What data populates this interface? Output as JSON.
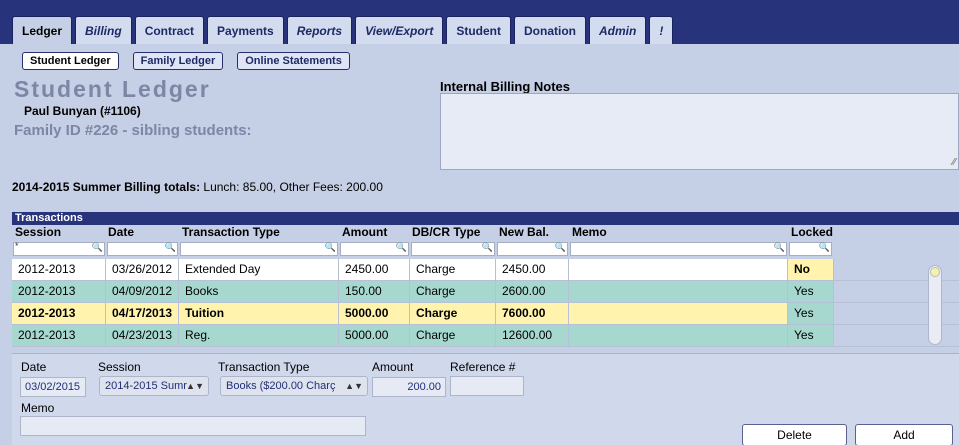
{
  "tabs": [
    {
      "label": "Ledger",
      "italic": false,
      "active": true
    },
    {
      "label": "Billing",
      "italic": true,
      "active": false
    },
    {
      "label": "Contract",
      "italic": false,
      "active": false
    },
    {
      "label": "Payments",
      "italic": false,
      "active": false
    },
    {
      "label": "Reports",
      "italic": true,
      "active": false
    },
    {
      "label": "View/Export",
      "italic": true,
      "active": false
    },
    {
      "label": "Student",
      "italic": false,
      "active": false
    },
    {
      "label": "Donation",
      "italic": false,
      "active": false
    },
    {
      "label": "Admin",
      "italic": true,
      "active": false
    },
    {
      "label": "!",
      "italic": true,
      "active": false
    }
  ],
  "subtabs": [
    "Student Ledger",
    "Family Ledger",
    "Online Statements"
  ],
  "page": {
    "title": "Student Ledger",
    "student": "Paul Bunyan  (#1106)",
    "family": "Family ID #226 - sibling students:"
  },
  "notes": {
    "title": "Internal Billing Notes",
    "value": ""
  },
  "totals": {
    "label": "2014-2015 Summer Billing totals:",
    "value": " Lunch: 85.00, Other Fees: 200.00"
  },
  "transactions": {
    "title": "Transactions",
    "columns": [
      "Session",
      "Date",
      "Transaction Type",
      "Amount",
      "DB/CR Type",
      "New Bal.",
      "Memo",
      "Locked"
    ],
    "filter_first_value": "*",
    "rows": [
      {
        "session": "2012-2013",
        "date": "03/26/2012",
        "type": "Extended Day",
        "amount": "2450.00",
        "dbcr": "Charge",
        "balance": "2450.00",
        "memo": "",
        "locked": "No",
        "style": "white"
      },
      {
        "session": "2012-2013",
        "date": "04/09/2012",
        "type": "Books",
        "amount": "150.00",
        "dbcr": "Charge",
        "balance": "2600.00",
        "memo": "",
        "locked": "Yes",
        "style": "green"
      },
      {
        "session": "2012-2013",
        "date": "04/17/2013",
        "type": "Tuition",
        "amount": "5000.00",
        "dbcr": "Charge",
        "balance": "7600.00",
        "memo": "",
        "locked": "Yes",
        "style": "yellow"
      },
      {
        "session": "2012-2013",
        "date": "04/23/2013",
        "type": "Reg.",
        "amount": "5000.00",
        "dbcr": "Charge",
        "balance": "12600.00",
        "memo": "",
        "locked": "Yes",
        "style": "green"
      }
    ]
  },
  "form": {
    "date_label": "Date",
    "date_value": "03/02/2015",
    "session_label": "Session",
    "session_value": "2014-2015 Sumr",
    "type_label": "Transaction Type",
    "type_value": "Books ($200.00 Charç",
    "amount_label": "Amount",
    "amount_value": "200.00",
    "ref_label": "Reference #",
    "ref_value": "",
    "memo_label": "Memo",
    "memo_value": "",
    "delete_label": "Delete",
    "add_label": "Add"
  },
  "colors": {
    "navy": "#27337a",
    "page_bg": "#c5cfe5",
    "row_green": "#a7d8cf",
    "row_yellow": "#fff3ad"
  }
}
